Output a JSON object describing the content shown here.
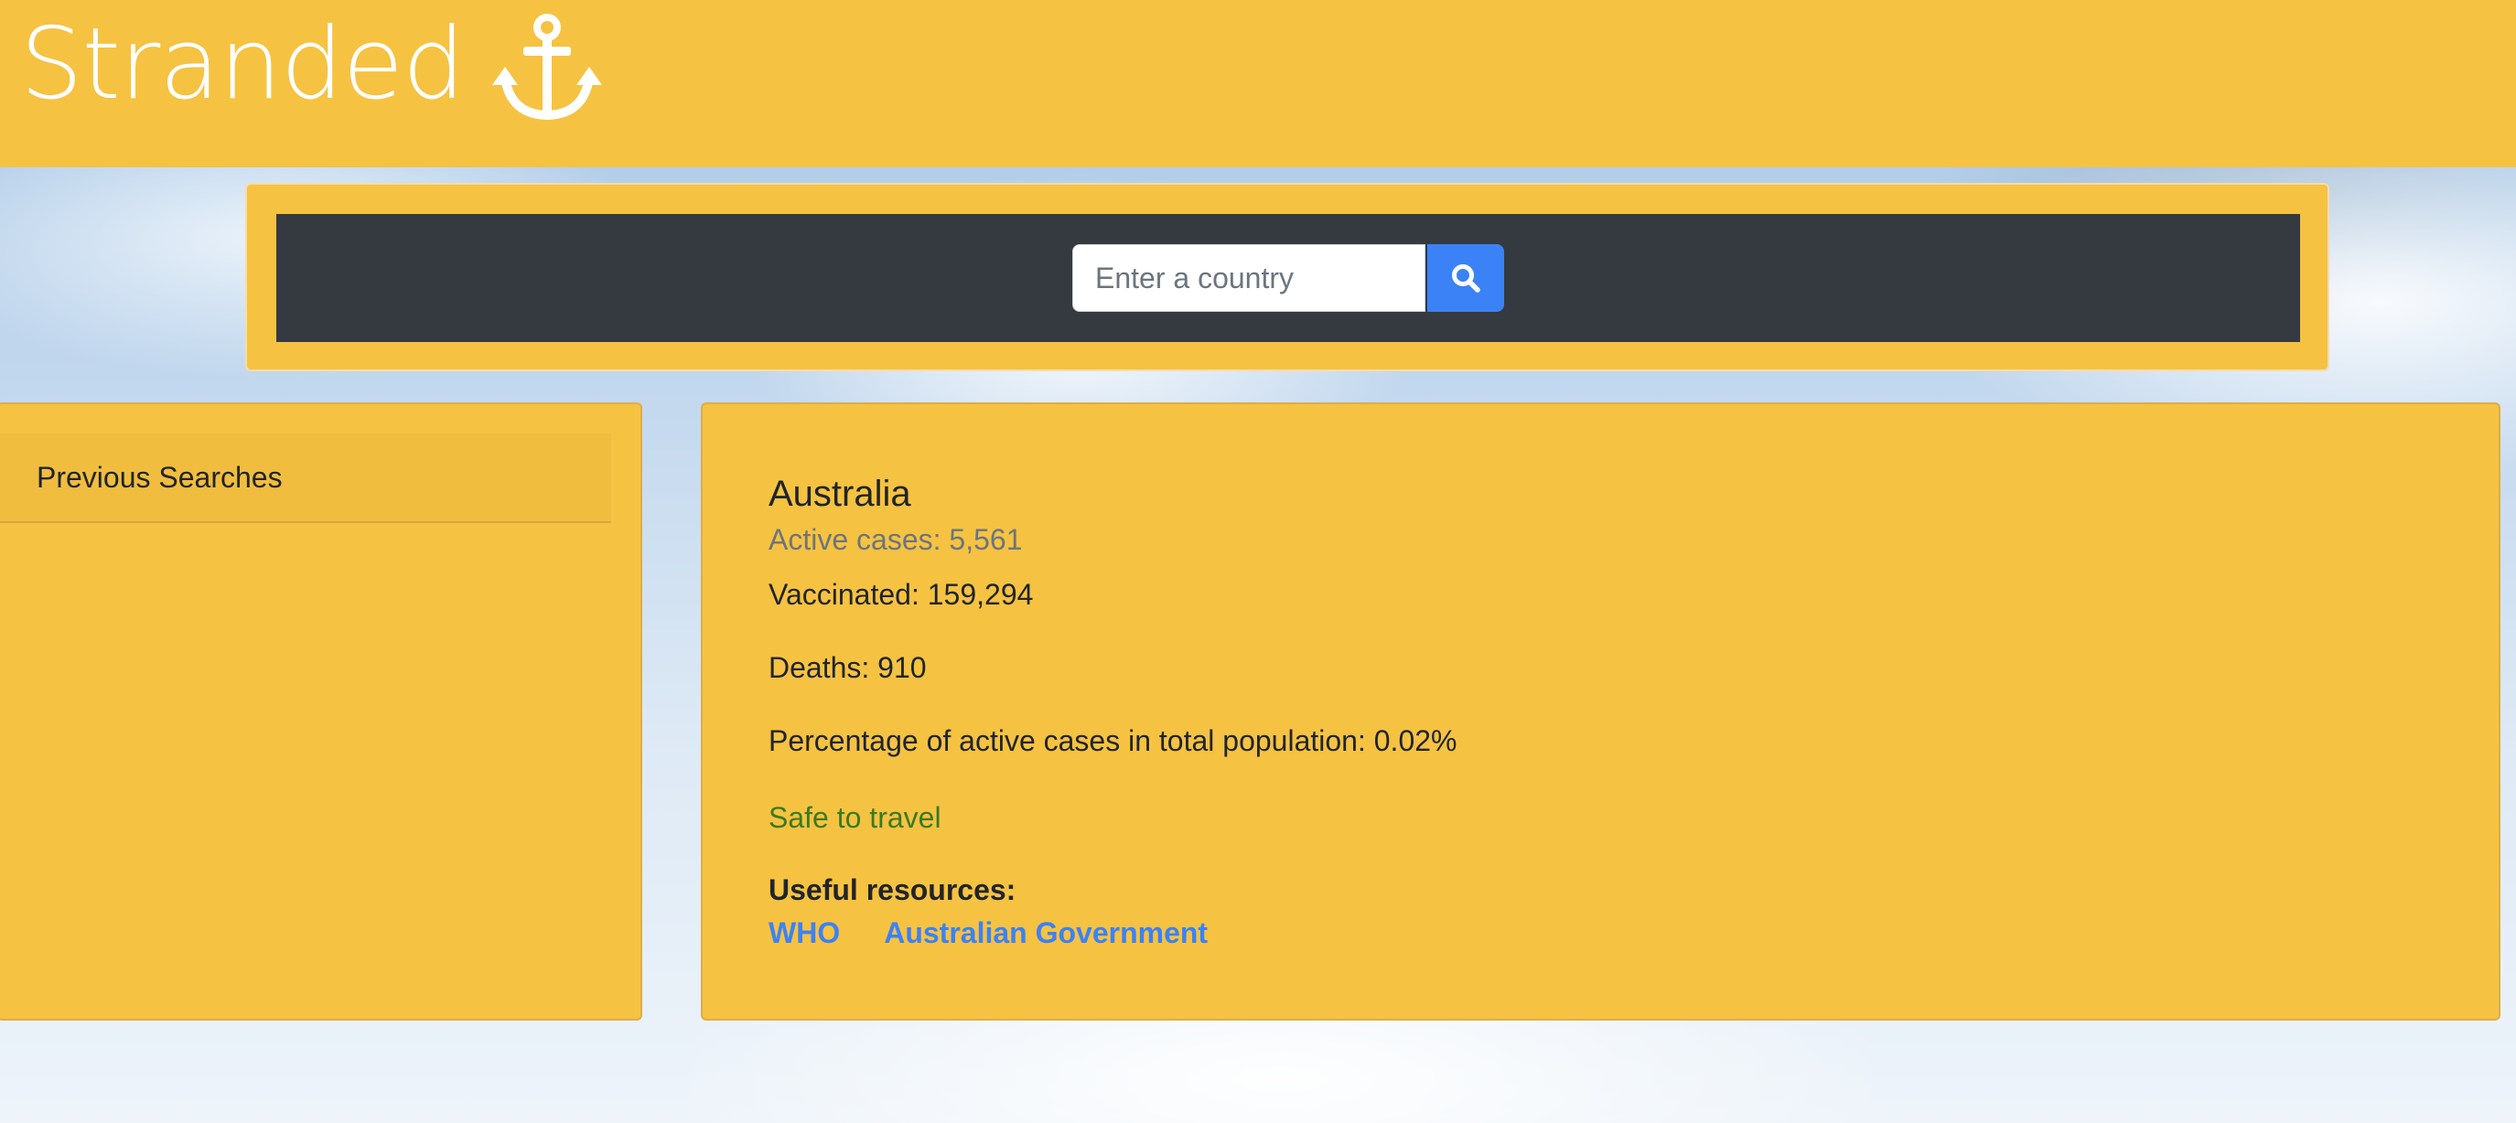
{
  "header": {
    "brand": "Stranded",
    "brand_icon": "anchor-icon",
    "background": "#f6c242"
  },
  "search": {
    "placeholder": "Enter a country",
    "value": "",
    "button_icon": "search-icon",
    "button_color": "#3b82f6"
  },
  "sidebar": {
    "title": "Previous Searches",
    "items": []
  },
  "country": {
    "name": "Australia",
    "active_cases": "Active cases: 5,561",
    "vaccinated": "Vaccinated: 159,294",
    "deaths": "Deaths: 910",
    "percentage": "Percentage of active cases in total population: 0.02%",
    "status": "Safe to travel",
    "status_color": "#3b7a1f",
    "resources_label": "Useful resources:",
    "resources": [
      {
        "label": "WHO"
      },
      {
        "label": "Australian Government"
      }
    ]
  }
}
